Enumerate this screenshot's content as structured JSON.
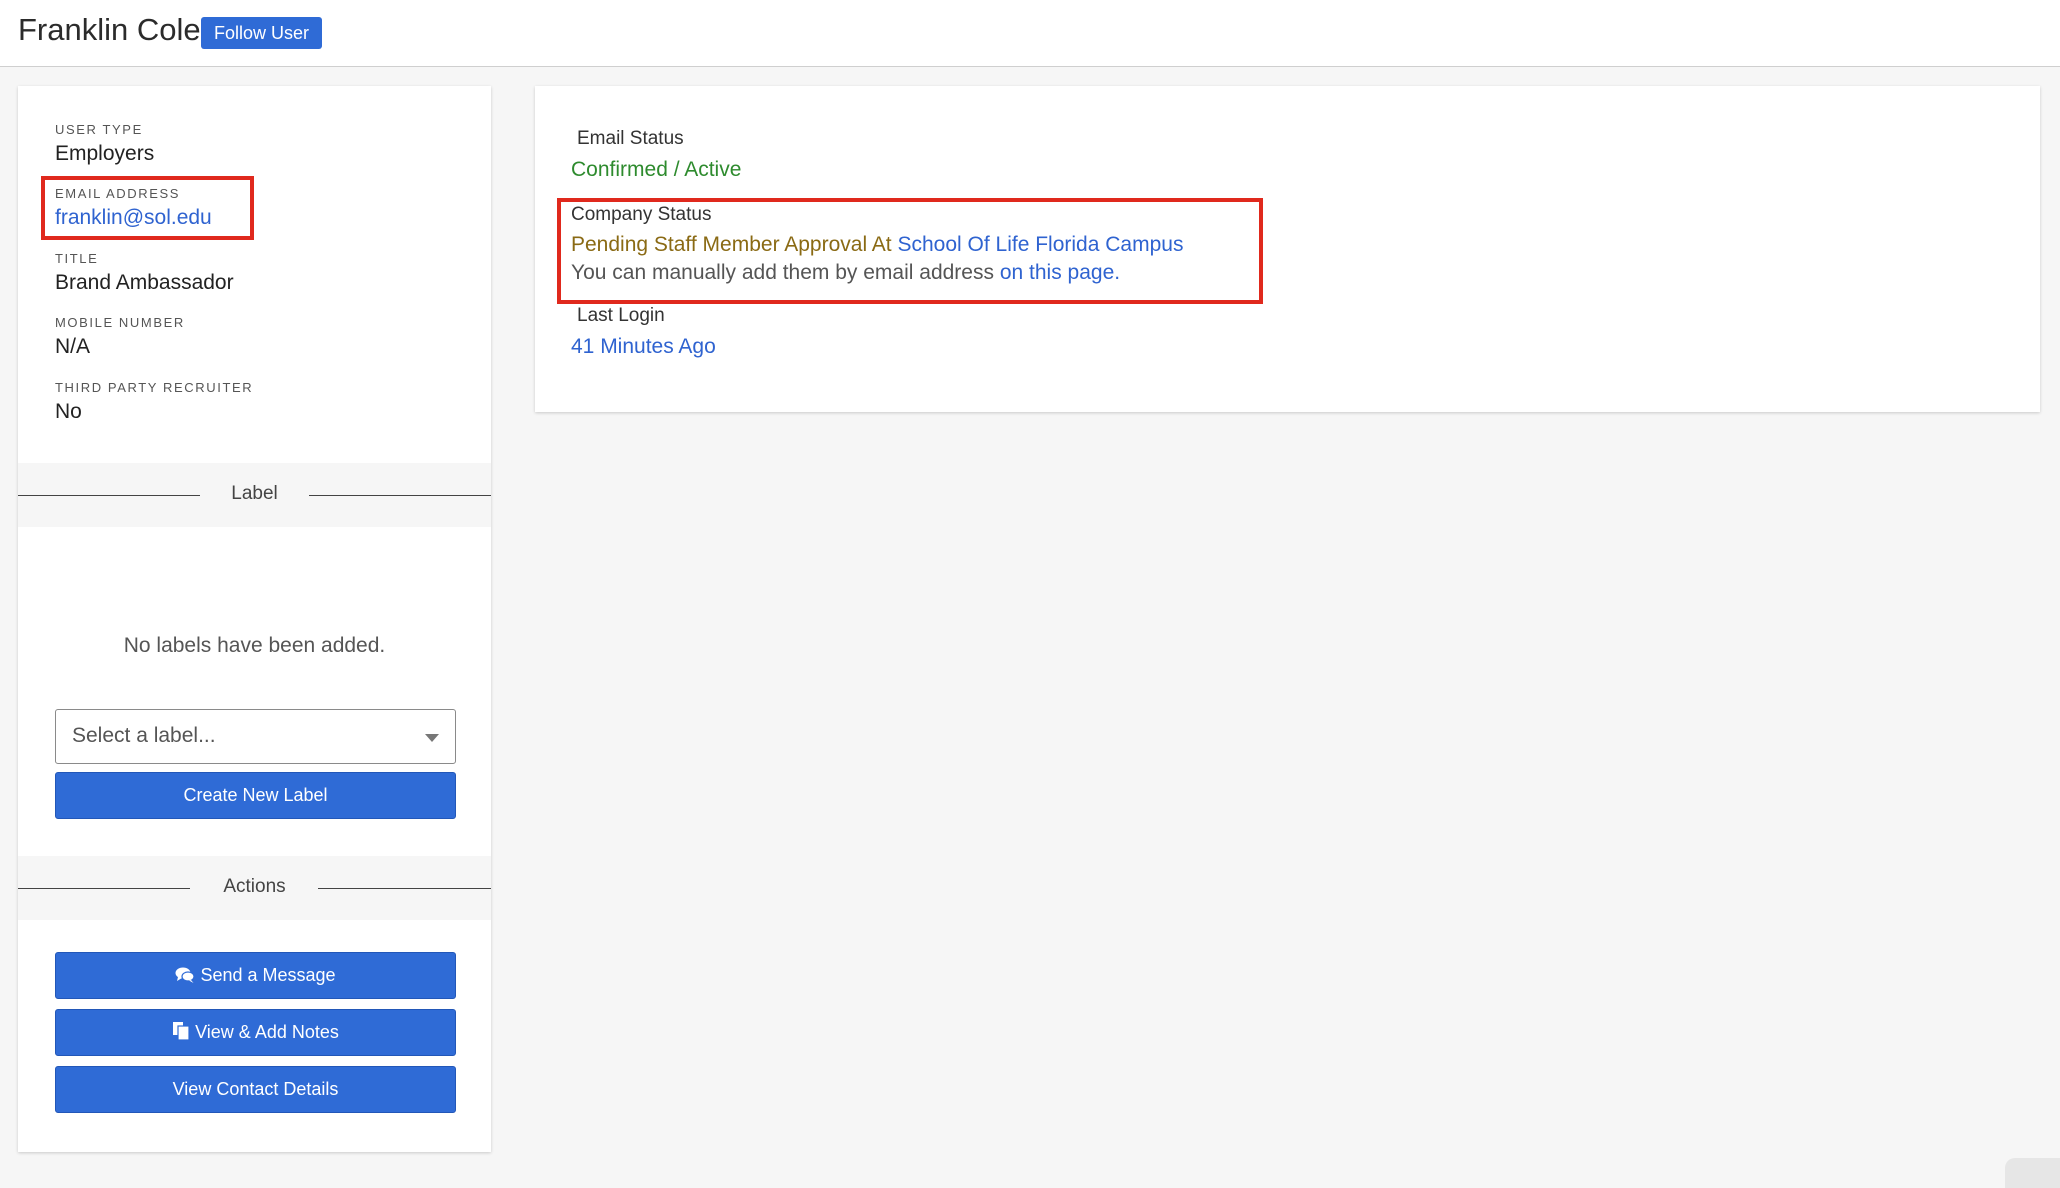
{
  "header": {
    "name": "Franklin Cole",
    "follow_label": "Follow User"
  },
  "profile": {
    "user_type_label": "USER TYPE",
    "user_type": "Employers",
    "email_label": "EMAIL ADDRESS",
    "email": "franklin@sol.edu",
    "title_label": "TITLE",
    "title": "Brand Ambassador",
    "mobile_label": "MOBILE NUMBER",
    "mobile": "N/A",
    "recruiter_label": "THIRD PARTY RECRUITER",
    "recruiter": "No"
  },
  "labels": {
    "section_title": "Label",
    "empty_text": "No labels have been added.",
    "select_placeholder": "Select a label...",
    "create_button": "Create New Label"
  },
  "actions": {
    "section_title": "Actions",
    "send_message": "Send a Message",
    "view_notes": "View & Add Notes",
    "view_contact": "View Contact Details"
  },
  "status": {
    "email_status_label": "Email Status",
    "email_status": "Confirmed / Active",
    "company_status_label": "Company Status",
    "company_pending": "Pending Staff Member Approval At",
    "company_name": "School Of Life Florida Campus",
    "company_note": "You can manually add them by email address",
    "company_link": "on this page.",
    "last_login_label": "Last Login",
    "last_login": "41 Minutes Ago"
  },
  "colors": {
    "primary": "#2f6bd6",
    "success": "#2e8b2e",
    "pending": "#8a6a14",
    "highlight": "#e0291d"
  }
}
